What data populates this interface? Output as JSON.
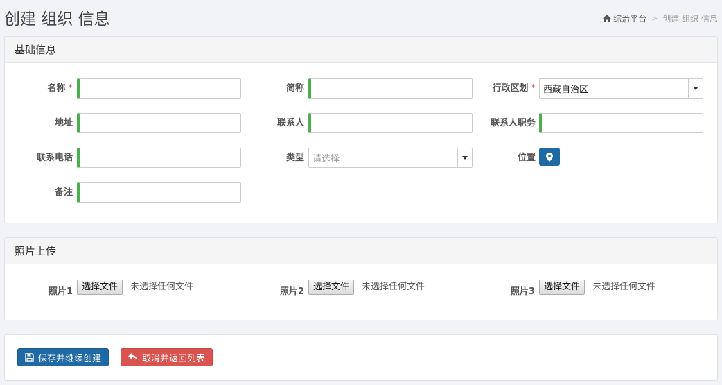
{
  "header": {
    "title": "创建 组织 信息",
    "breadcrumb": {
      "home": "综治平台",
      "separator": ">",
      "current": "创建 组织 信息"
    }
  },
  "basic_panel": {
    "heading": "基础信息",
    "fields": {
      "name": {
        "label": "名称",
        "required": "*",
        "value": ""
      },
      "short_name": {
        "label": "简称",
        "value": ""
      },
      "region": {
        "label": "行政区划",
        "required": "*",
        "value": "西藏自治区"
      },
      "address": {
        "label": "地址",
        "value": ""
      },
      "contact": {
        "label": "联系人",
        "value": ""
      },
      "contact_title": {
        "label": "联系人职务",
        "value": ""
      },
      "phone": {
        "label": "联系电话",
        "value": ""
      },
      "type": {
        "label": "类型",
        "placeholder": "请选择"
      },
      "location": {
        "label": "位置",
        "icon": "map-marker-icon"
      },
      "remark": {
        "label": "备注",
        "value": ""
      }
    }
  },
  "photo_panel": {
    "heading": "照片上传",
    "photos": [
      {
        "label": "照片1",
        "button": "选择文件",
        "status": "未选择任何文件"
      },
      {
        "label": "照片2",
        "button": "选择文件",
        "status": "未选择任何文件"
      },
      {
        "label": "照片3",
        "button": "选择文件",
        "status": "未选择任何文件"
      }
    ]
  },
  "actions": {
    "save_continue": "保存并继续创建",
    "cancel_return": "取消并返回列表"
  },
  "colors": {
    "primary": "#1f6aa5",
    "danger": "#d9534f",
    "input_accent": "#4cae4c",
    "required": "#d9534f"
  }
}
